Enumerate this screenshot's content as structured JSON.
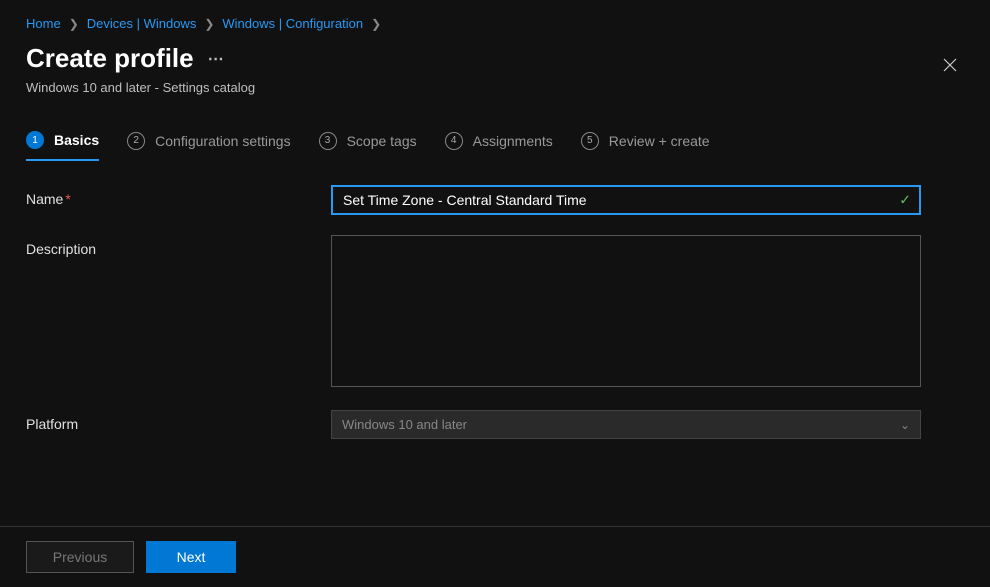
{
  "breadcrumb": {
    "items": [
      {
        "label": "Home"
      },
      {
        "label": "Devices | Windows"
      },
      {
        "label": "Windows | Configuration"
      }
    ]
  },
  "header": {
    "title": "Create profile",
    "subtitle": "Windows 10 and later - Settings catalog"
  },
  "stepper": {
    "steps": [
      {
        "num": "1",
        "label": "Basics"
      },
      {
        "num": "2",
        "label": "Configuration settings"
      },
      {
        "num": "3",
        "label": "Scope tags"
      },
      {
        "num": "4",
        "label": "Assignments"
      },
      {
        "num": "5",
        "label": "Review + create"
      }
    ]
  },
  "form": {
    "name_label": "Name",
    "name_value": "Set Time Zone - Central Standard Time",
    "description_label": "Description",
    "description_value": "",
    "platform_label": "Platform",
    "platform_value": "Windows 10 and later"
  },
  "footer": {
    "previous": "Previous",
    "next": "Next"
  }
}
